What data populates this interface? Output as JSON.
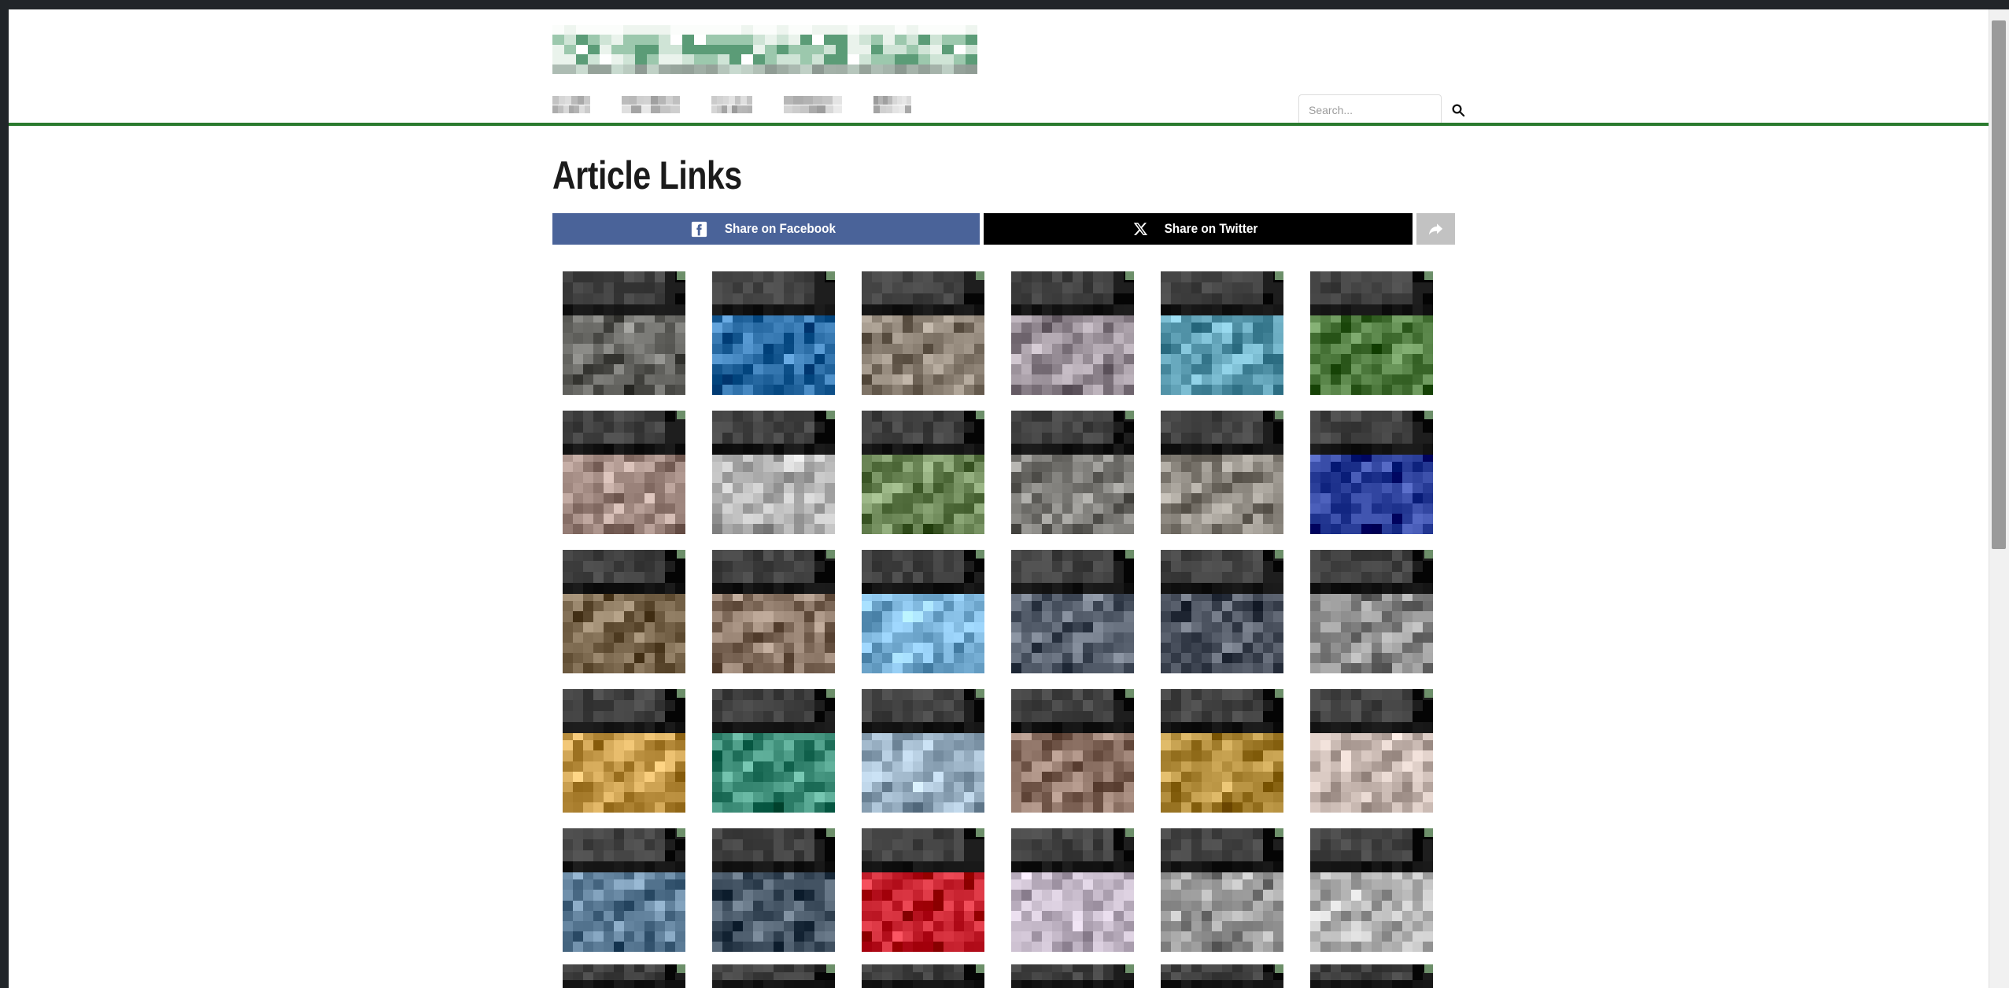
{
  "browser": {
    "chrome_color": "#212529",
    "scrollbar_color": "#9a9a9a"
  },
  "header": {
    "logo": {
      "name": "site-logo",
      "state": "pixelated-redacted",
      "color": "#7fae8e"
    },
    "nav": {
      "items": [
        {
          "label": "",
          "state": "pixelated-redacted"
        },
        {
          "label": "",
          "state": "pixelated-redacted"
        },
        {
          "label": "",
          "state": "pixelated-redacted"
        },
        {
          "label": "",
          "state": "pixelated-redacted"
        },
        {
          "label": "",
          "state": "pixelated-redacted"
        }
      ]
    },
    "search": {
      "placeholder": "Search...",
      "value": "",
      "icon": "search-icon"
    },
    "divider_color": "#2a7a2e"
  },
  "main": {
    "title": "Article Links",
    "share": {
      "facebook_label": "Share on Facebook",
      "facebook_color": "#4a6399",
      "facebook_icon": "facebook-icon",
      "twitter_label": "Share on Twitter",
      "twitter_color": "#000000",
      "twitter_icon": "x-twitter-icon",
      "more_icon": "share-forward-icon",
      "more_color": "#c2c2c2"
    },
    "gallery": {
      "columns": 6,
      "visible_rows": 5,
      "badge_color": "#6d8f6a",
      "thumbnails": [
        {
          "title": "",
          "state": "pixelated-redacted",
          "tone": "#6a6a66"
        },
        {
          "title": "",
          "state": "pixelated-redacted",
          "tone": "#2d6fa8"
        },
        {
          "title": "",
          "state": "pixelated-redacted",
          "tone": "#8a7f72"
        },
        {
          "title": "",
          "state": "pixelated-redacted",
          "tone": "#9a9099"
        },
        {
          "title": "",
          "state": "pixelated-redacted",
          "tone": "#5fa0b5"
        },
        {
          "title": "",
          "state": "pixelated-redacted",
          "tone": "#4e7a3e"
        },
        {
          "title": "",
          "state": "pixelated-redacted",
          "tone": "#a28a82"
        },
        {
          "title": "",
          "state": "pixelated-redacted",
          "tone": "#b7b7b7"
        },
        {
          "title": "",
          "state": "pixelated-redacted",
          "tone": "#6f8a5a"
        },
        {
          "title": "",
          "state": "pixelated-redacted",
          "tone": "#7d7c78"
        },
        {
          "title": "",
          "state": "pixelated-redacted",
          "tone": "#8d8880"
        },
        {
          "title": "",
          "state": "pixelated-redacted",
          "tone": "#2b3f9a"
        },
        {
          "title": "",
          "state": "pixelated-redacted",
          "tone": "#7d6a50"
        },
        {
          "title": "",
          "state": "pixelated-redacted",
          "tone": "#8a7565"
        },
        {
          "title": "",
          "state": "pixelated-redacted",
          "tone": "#7fb7dd"
        },
        {
          "title": "",
          "state": "pixelated-redacted",
          "tone": "#5b6472"
        },
        {
          "title": "",
          "state": "pixelated-redacted",
          "tone": "#4c5360"
        },
        {
          "title": "",
          "state": "pixelated-redacted",
          "tone": "#8a8a8a"
        },
        {
          "title": "",
          "state": "pixelated-redacted",
          "tone": "#c59a4a"
        },
        {
          "title": "",
          "state": "pixelated-redacted",
          "tone": "#3f8f7a"
        },
        {
          "title": "",
          "state": "pixelated-redacted",
          "tone": "#9fb6c9"
        },
        {
          "title": "",
          "state": "pixelated-redacted",
          "tone": "#8a6f62"
        },
        {
          "title": "",
          "state": "pixelated-redacted",
          "tone": "#b08b3a"
        },
        {
          "title": "",
          "state": "pixelated-redacted",
          "tone": "#c9b9b2"
        },
        {
          "title": "",
          "state": "pixelated-redacted",
          "tone": "#5f7f9a"
        },
        {
          "title": "",
          "state": "pixelated-redacted",
          "tone": "#4a5a6a"
        },
        {
          "title": "",
          "state": "pixelated-redacted",
          "tone": "#c21d2a"
        },
        {
          "title": "",
          "state": "pixelated-redacted",
          "tone": "#c0b4c4"
        },
        {
          "title": "",
          "state": "pixelated-redacted",
          "tone": "#9a9a9a"
        },
        {
          "title": "",
          "state": "pixelated-redacted",
          "tone": "#b5b5b5"
        }
      ],
      "partial_row": [
        {
          "title": "",
          "state": "pixelated-redacted"
        },
        {
          "title": "",
          "state": "pixelated-redacted"
        },
        {
          "title": "",
          "state": "pixelated-redacted"
        },
        {
          "title": "",
          "state": "pixelated-redacted"
        },
        {
          "title": "",
          "state": "pixelated-redacted"
        },
        {
          "title": "",
          "state": "pixelated-redacted"
        }
      ]
    }
  }
}
